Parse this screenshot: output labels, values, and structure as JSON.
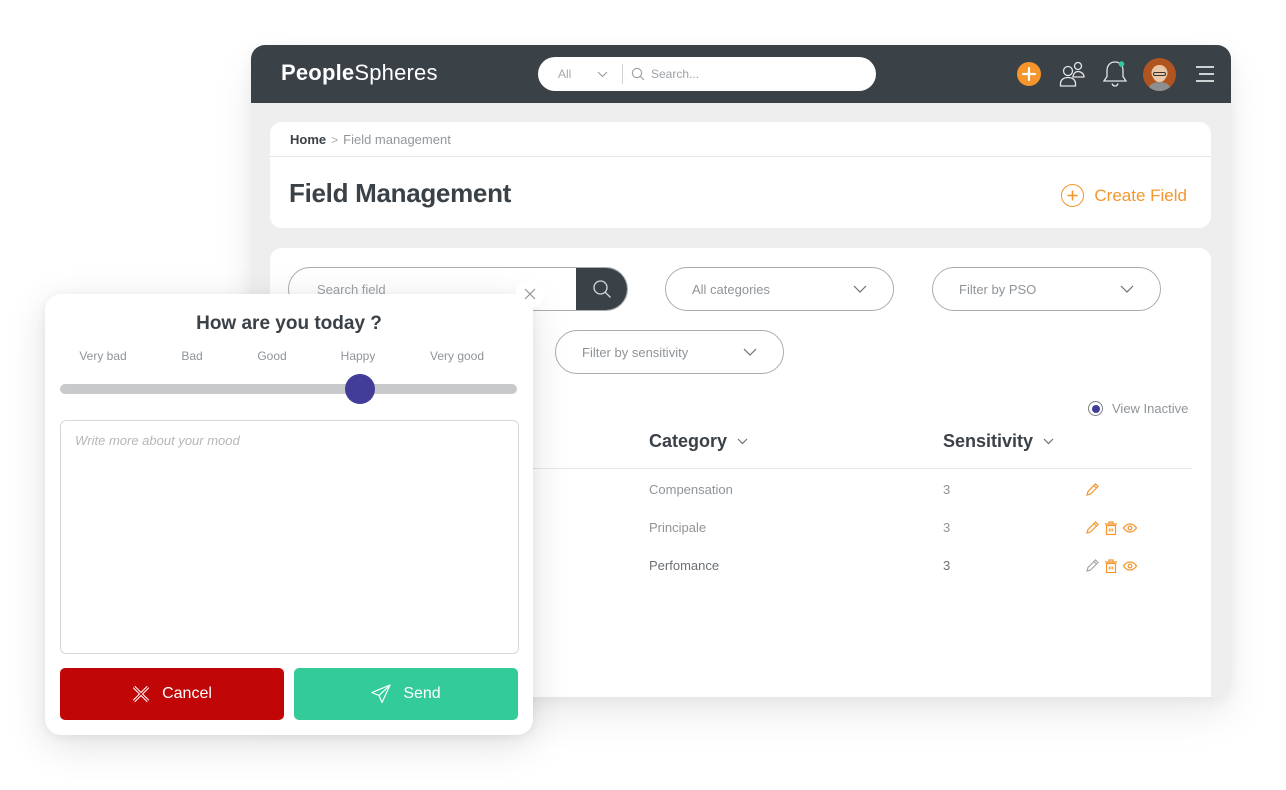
{
  "app": {
    "logo": {
      "part1": "People",
      "part2": "Spheres"
    },
    "global_search": {
      "scope": "All",
      "placeholder": "Search..."
    },
    "topbar_icons": [
      "plus-icon",
      "users-icon",
      "bell-icon",
      "avatar",
      "menu-icon"
    ],
    "colors": {
      "topbar": "#3a4147",
      "accent": "#f5952c",
      "primary": "#433d9a",
      "danger": "#c00606",
      "success": "#34cb9b",
      "notification_dot": "#34cb9b"
    }
  },
  "breadcrumb": {
    "home": "Home",
    "separator": ">",
    "current": "Field management"
  },
  "page": {
    "title": "Field Management",
    "create_button": "Create Field"
  },
  "filters": {
    "search_placeholder": "Search field",
    "categories": "All categories",
    "pso": "Filter by PSO",
    "sensitivity": "Filter by sensitivity",
    "view_inactive": "View Inactive",
    "view_inactive_selected": true
  },
  "table": {
    "columns": [
      "Category",
      "Sensitivity"
    ],
    "rows": [
      {
        "category": "Compensation",
        "sensitivity": "3",
        "actions": [
          "edit"
        ]
      },
      {
        "category": "Principale",
        "sensitivity": "3",
        "actions": [
          "edit",
          "delete",
          "view"
        ]
      },
      {
        "category": "Perfomance",
        "sensitivity": "3",
        "actions": [
          "edit",
          "delete",
          "view"
        ]
      }
    ]
  },
  "mood_modal": {
    "title": "How are you today ?",
    "scale": [
      "Very bad",
      "Bad",
      "Good",
      "Happy",
      "Very good"
    ],
    "selected": "Happy",
    "slider_value_fraction": 0.656,
    "textarea_placeholder": "Write more about your mood",
    "cancel_label": "Cancel",
    "send_label": "Send"
  }
}
